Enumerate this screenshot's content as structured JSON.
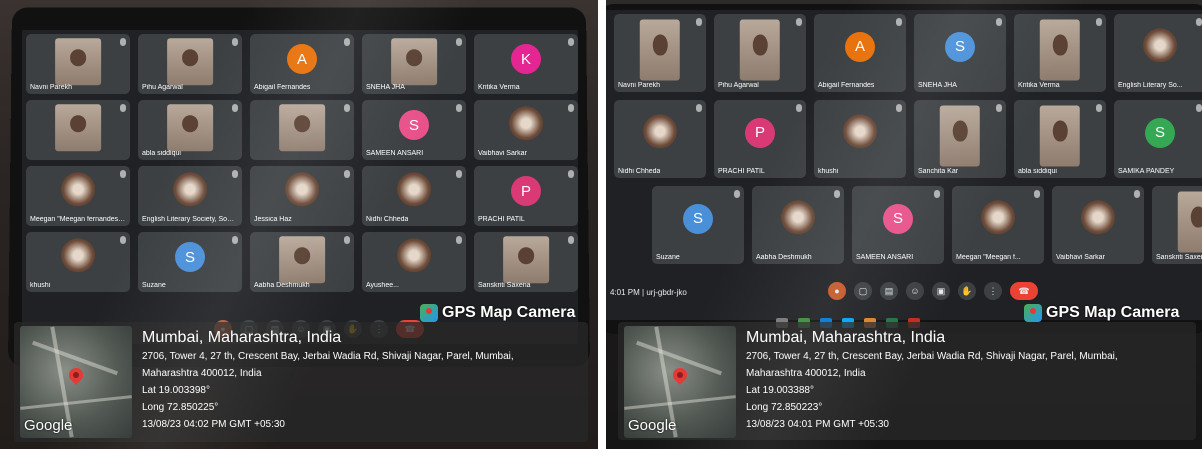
{
  "left": {
    "tiles": [
      {
        "name": "Navni Parekh",
        "kind": "cam"
      },
      {
        "name": "Pihu Agarwal",
        "kind": "cam"
      },
      {
        "name": "Abigail Fernandes",
        "kind": "avatar",
        "letter": "A",
        "color": "#e8710a"
      },
      {
        "name": "SNEHA JHA",
        "kind": "cam"
      },
      {
        "name": "Kritika Verma",
        "kind": "avatar",
        "letter": "K",
        "color": "#e52592"
      },
      {
        "name": "",
        "kind": "cam"
      },
      {
        "name": "abla siddiqui",
        "kind": "cam"
      },
      {
        "name": "",
        "kind": "cam"
      },
      {
        "name": "SAMEEN ANSARI",
        "kind": "avatar",
        "letter": "S",
        "color": "#e8528a"
      },
      {
        "name": "Vaibhavi Sarkar",
        "kind": "pic"
      },
      {
        "name": "Meegan \"Meegan fernandes ...",
        "kind": "pic"
      },
      {
        "name": "English Literary Society, Sophi...",
        "kind": "pic"
      },
      {
        "name": "Jessica Haz",
        "kind": "pic"
      },
      {
        "name": "Nidhi Chheda",
        "kind": "pic"
      },
      {
        "name": "PRACHI PATIL",
        "kind": "avatar",
        "letter": "P",
        "color": "#d93a76"
      },
      {
        "name": "khushi",
        "kind": "pic"
      },
      {
        "name": "Suzane",
        "kind": "avatar",
        "letter": "S",
        "color": "#4a90d9"
      },
      {
        "name": "Aabha Deshmukh",
        "kind": "cam"
      },
      {
        "name": "Ayushee...",
        "kind": "pic"
      },
      {
        "name": "Sanskriti Saxena",
        "kind": "cam"
      }
    ],
    "gps": {
      "brand": "GPS Map Camera",
      "city": "Mumbai, Maharashtra, India",
      "address1": "2706, Tower 4, 27 th, Crescent Bay, Jerbai Wadia Rd, Shivaji Nagar, Parel, Mumbai,",
      "address2": "Maharashtra 400012, India",
      "lat": "Lat 19.003398°",
      "long": "Long 72.850225°",
      "datetime": "13/08/23 04:02 PM GMT +05:30",
      "map_label": "Google"
    }
  },
  "right": {
    "tiles": [
      {
        "name": "Navni Parekh",
        "kind": "cam"
      },
      {
        "name": "Pihu Agarwal",
        "kind": "cam"
      },
      {
        "name": "Abigail Fernandes",
        "kind": "avatar",
        "letter": "A",
        "color": "#e8710a"
      },
      {
        "name": "SNEHA JHA",
        "kind": "avatar",
        "letter": "S",
        "color": "#4a90d9"
      },
      {
        "name": "Kritika Verma",
        "kind": "cam"
      },
      {
        "name": "English Literary So...",
        "kind": "pic"
      },
      {
        "name": "Nidhi Chheda",
        "kind": "pic"
      },
      {
        "name": "PRACHI PATIL",
        "kind": "avatar",
        "letter": "P",
        "color": "#d93a76"
      },
      {
        "name": "khushi",
        "kind": "pic"
      },
      {
        "name": "Sanchita Kar",
        "kind": "cam"
      },
      {
        "name": "abla siddiqui",
        "kind": "cam"
      },
      {
        "name": "SAMIKA PANDEY",
        "kind": "avatar",
        "letter": "S",
        "color": "#34a853"
      },
      {
        "name": "Suzane",
        "kind": "avatar",
        "letter": "S",
        "color": "#4a90d9"
      },
      {
        "name": "Aabha Deshmukh",
        "kind": "pic"
      },
      {
        "name": "SAMEEN ANSARI",
        "kind": "avatar",
        "letter": "S",
        "color": "#e8528a"
      },
      {
        "name": "Meegan \"Meegan f...",
        "kind": "pic"
      },
      {
        "name": "Vaibhavi Sarkar",
        "kind": "pic"
      },
      {
        "name": "Sanskriti Saxena",
        "kind": "cam"
      }
    ],
    "meeting": {
      "time": "4:01 PM",
      "separator": "|",
      "code": "urj-gbdr-jko"
    },
    "gps": {
      "brand": "GPS Map Camera",
      "city": "Mumbai, Maharashtra, India",
      "address1": "2706, Tower 4, 27 th, Crescent Bay, Jerbai Wadia Rd, Shivaji Nagar, Parel, Mumbai,",
      "address2": "Maharashtra 400012, India",
      "lat": "Lat 19.003388°",
      "long": "Long 72.850223°",
      "datetime": "13/08/23 04:01 PM GMT +05:30",
      "map_label": "Google"
    }
  }
}
